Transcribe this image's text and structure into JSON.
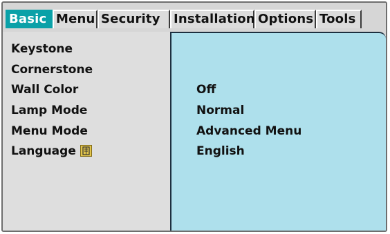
{
  "tabs": [
    {
      "label": "Basic",
      "active": true
    },
    {
      "label": "Menu",
      "active": false
    },
    {
      "label": "Security",
      "active": false
    },
    {
      "label": "Installation",
      "active": false
    },
    {
      "label": "Options",
      "active": false
    },
    {
      "label": "Tools",
      "active": false
    }
  ],
  "items": [
    {
      "label": "Keystone",
      "value": ""
    },
    {
      "label": "Cornerstone",
      "value": ""
    },
    {
      "label": "Wall Color",
      "value": "Off"
    },
    {
      "label": "Lamp Mode",
      "value": "Normal"
    },
    {
      "label": "Menu Mode",
      "value": "Advanced Menu"
    },
    {
      "label": "Language",
      "value": "English",
      "icon": "language-icon"
    }
  ],
  "colors": {
    "active_tab": "#0aa1a8",
    "value_pane": "#aee0ec",
    "label_pane": "#dedede"
  }
}
